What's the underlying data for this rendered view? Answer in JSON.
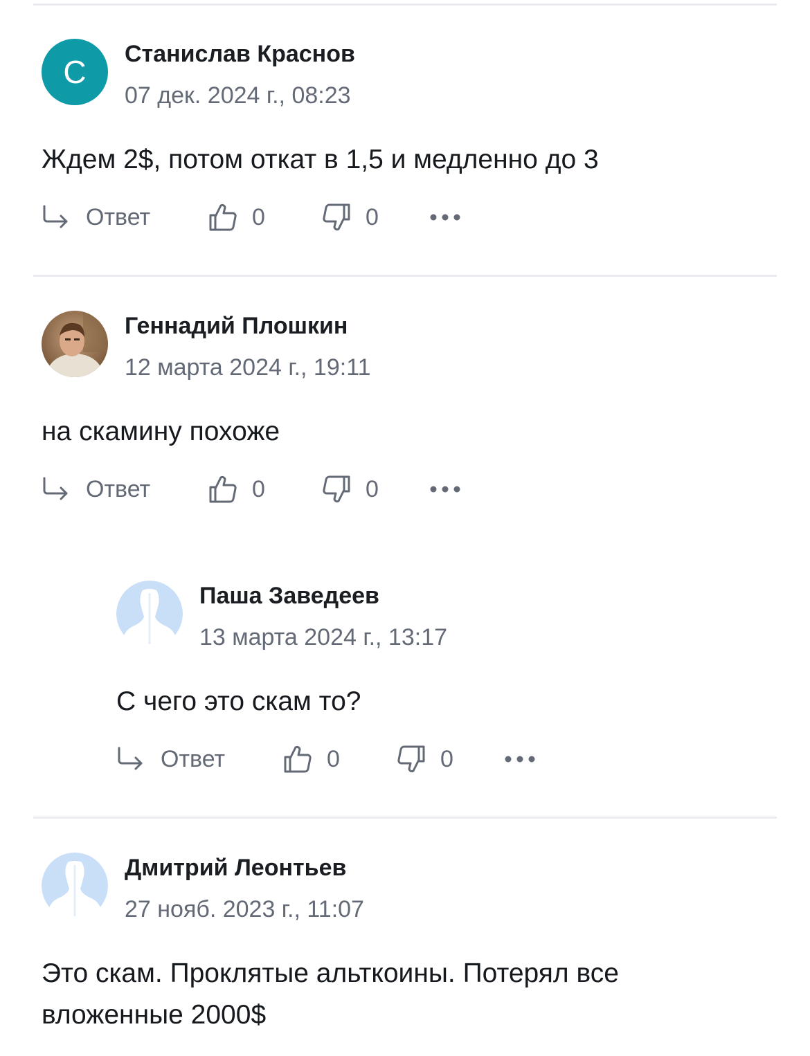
{
  "comments": [
    {
      "author": "Станислав Краснов",
      "date": "07 дек. 2024 г., 08:23",
      "avatar_letter": "С",
      "text": "Ждем 2$, потом откат в 1,5 и медленно до 3",
      "reply_label": "Ответ",
      "likes": "0",
      "dislikes": "0"
    },
    {
      "author": "Геннадий Плошкин",
      "date": "12 марта 2024 г., 19:11",
      "text": "на скамину похоже",
      "reply_label": "Ответ",
      "likes": "0",
      "dislikes": "0"
    },
    {
      "author": "Паша Заведеев",
      "date": "13 марта 2024 г., 13:17",
      "text": "С чего это скам то?",
      "reply_label": "Ответ",
      "likes": "0",
      "dislikes": "0"
    },
    {
      "author": "Дмитрий Леонтьев",
      "date": "27 нояб. 2023 г., 11:07",
      "text": "Это скам. Проклятые альткоины. Потерял все вложенные 2000$"
    }
  ],
  "colors": {
    "avatar_teal": "#0e9aa7",
    "placeholder_avatar": "#c9dff7",
    "muted_text": "#636a76",
    "divider": "#e9ebee"
  },
  "icons": [
    "reply-icon",
    "thumbs-up-icon",
    "thumbs-down-icon",
    "more-icon",
    "user-placeholder-icon"
  ]
}
